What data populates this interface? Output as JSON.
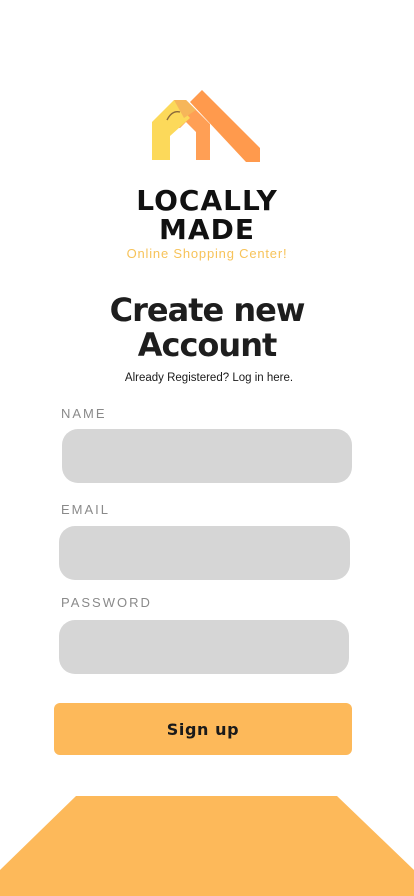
{
  "brand": {
    "logo_icon": "house-roof-logo-icon",
    "name_line1": "LOCALLY",
    "name_line2": "MADE",
    "tagline": "Online Shopping Center!"
  },
  "header": {
    "title_line1": "Create new",
    "title_line2": "Account",
    "login_prompt": "Already Registered? Log in here."
  },
  "form": {
    "name_label": "NAME",
    "name_value": "",
    "email_label": "EMAIL",
    "email_value": "",
    "password_label": "PASSWORD",
    "password_value": "",
    "signup_label": "Sign up"
  },
  "colors": {
    "accent": "#fdb95a",
    "tagline": "#f7c35a",
    "logo_orange": "#ff9a4d",
    "logo_yellow": "#fcd95a",
    "input_bg": "#d6d6d6"
  }
}
